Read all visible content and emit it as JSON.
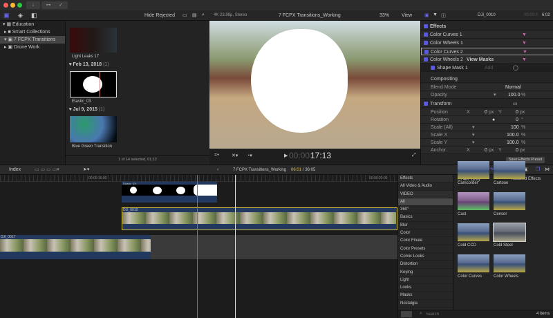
{
  "library": {
    "items": [
      {
        "label": "Education"
      },
      {
        "label": "Smart Collections"
      },
      {
        "label": "7 FCPX Transitions"
      },
      {
        "label": "Drone Work"
      }
    ]
  },
  "browser": {
    "filter": "Hide Rejected",
    "clips": [
      {
        "label": "Light Leaks 17"
      },
      {
        "label": "Elastic_03"
      },
      {
        "label": "Blue Green Transition"
      }
    ],
    "groups": [
      {
        "date": "Feb 13, 2018",
        "count": "(1)"
      },
      {
        "date": "Jul 9, 2015",
        "count": "(1)"
      }
    ],
    "status": "1 of 14 selected, 01;12"
  },
  "viewer": {
    "format": "4K 23.98p, Stereo",
    "project": "7 FCPX Transitions_Working",
    "zoom": "33%",
    "view": "View",
    "timecode_dim": "00:00:",
    "timecode": "17:13"
  },
  "inspector": {
    "clip": "DJI_0010",
    "duration_dim": "00:00:0",
    "duration": "6;02",
    "effects_label": "Effects",
    "effects": [
      "Color Curves 1",
      "Color Wheels 1",
      "Color Curves 2",
      "Color Wheels 2"
    ],
    "view_masks": "View Masks",
    "shape_mask": "Shape Mask 1",
    "add": "Add",
    "compositing": "Compositing",
    "blend_mode_label": "Blend Mode",
    "blend_mode": "Normal",
    "opacity_label": "Opacity",
    "opacity": "100.0",
    "transform": "Transform",
    "rows": [
      {
        "label": "Position",
        "x": "0",
        "y": "0",
        "xu": "px",
        "yu": "px"
      },
      {
        "label": "Rotation",
        "v": "0",
        "u": "°"
      },
      {
        "label": "Scale (All)",
        "v": "100",
        "u": "%"
      },
      {
        "label": "Scale X",
        "v": "100.0",
        "u": "%"
      },
      {
        "label": "Scale Y",
        "v": "100.0",
        "u": "%"
      },
      {
        "label": "Anchor",
        "x": "0",
        "y": "0",
        "xu": "px",
        "yu": "px"
      }
    ],
    "save_preset": "Save Effects Preset"
  },
  "timeline": {
    "index": "Index",
    "project": "7 FCPX Transitions_Working",
    "position": "06:01",
    "total": "/ 36:05",
    "ruler": [
      "00:00:16:00",
      "00:00:20:00"
    ],
    "clips": [
      "Elastic_03",
      "DJI_0010",
      "DJI_0017"
    ]
  },
  "effects": {
    "header": "Effects",
    "four_k": "4K Only",
    "installed": "Installed Effects",
    "categories": [
      "All Video & Audio",
      "VIDEO",
      "All",
      "360°",
      "Basics",
      "Blur",
      "Color",
      "Color Finale",
      "Color Presets",
      "Comic Looks",
      "Distortion",
      "Keying",
      "Light",
      "Looks",
      "Masks",
      "Nostalgia"
    ],
    "thumbs": [
      "Camcorder",
      "Cartoon",
      "Cast",
      "Censor",
      "Cold CCD",
      "Cold Steel",
      "Color Curves",
      "Color Wheels"
    ],
    "search_placeholder": "Search",
    "count": "4 items"
  }
}
